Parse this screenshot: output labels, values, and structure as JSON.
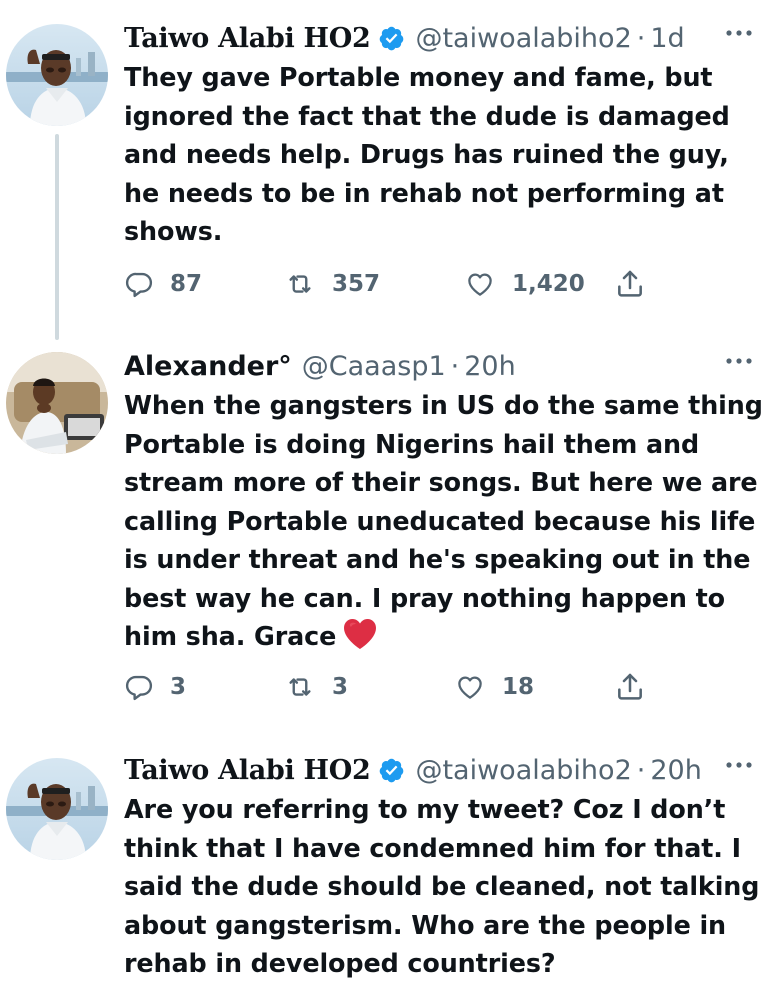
{
  "tweets": [
    {
      "author_name": "Taiwo Alabi 𝐇𝐎𝟐",
      "verified": true,
      "handle": "@taiwoalabiho2",
      "separator": "·",
      "time": "1d",
      "text": "They gave Portable money and fame, but ignored the fact that the dude is damaged and needs help. Drugs has ruined the guy, he needs to be in rehab not performing at shows.",
      "replies": "87",
      "retweets": "357",
      "likes": "1,420"
    },
    {
      "author_name": "Alexander°",
      "verified": false,
      "handle": "@Caaasp1",
      "separator": "·",
      "time": "20h",
      "text": "When the gangsters in US do the same thing Portable is doing Nigerins hail them and stream more of their songs. But here we are calling Portable uneducated because his life is under threat and he's speaking out in the best way he can. I pray nothing happen to him sha. Grace",
      "emoji": "red-heart",
      "replies": "3",
      "retweets": "3",
      "likes": "18"
    },
    {
      "author_name": "Taiwo Alabi 𝐇𝐎𝟐",
      "verified": true,
      "handle": "@taiwoalabiho2",
      "separator": "·",
      "time": "20h",
      "text": "Are you referring to my tweet? Coz I don’t think that I have condemned him for that. I said the dude should be cleaned, not talking about gangsterism. Who are the people in rehab in  developed countries?"
    }
  ],
  "icons": {
    "reply": "reply-icon",
    "retweet": "retweet-icon",
    "like": "heart-icon",
    "share": "share-icon",
    "more": "more-icon",
    "verified": "verified-badge-icon"
  },
  "colors": {
    "text": "#0f1419",
    "secondary": "#536471",
    "verified": "#1d9bf0",
    "thread_line": "#cfd9de"
  }
}
